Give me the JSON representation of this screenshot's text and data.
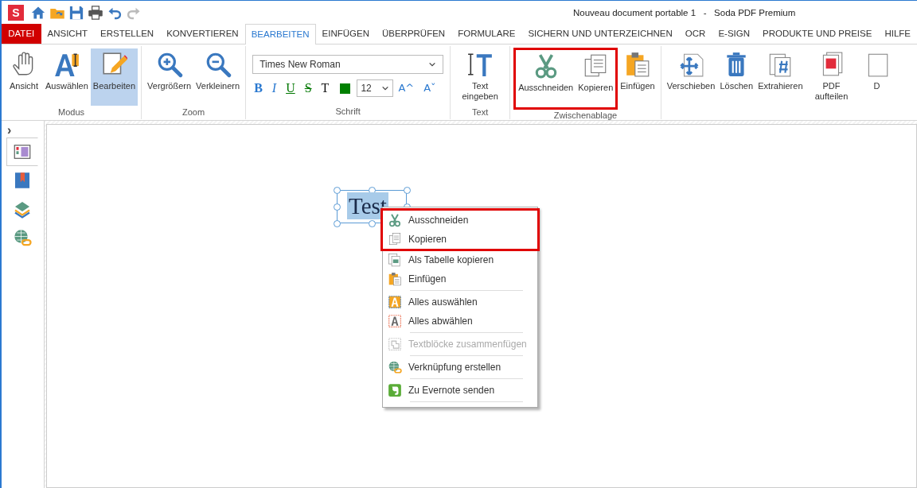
{
  "window": {
    "title": "Nouveau document portable 1   -   Soda PDF Premium",
    "logo": "S"
  },
  "tabs": [
    {
      "label": "DATEI",
      "kind": "file",
      "selected": false
    },
    {
      "label": "ANSICHT",
      "kind": "tab",
      "selected": false
    },
    {
      "label": "ERSTELLEN",
      "kind": "tab",
      "selected": false
    },
    {
      "label": "KONVERTIEREN",
      "kind": "tab",
      "selected": false
    },
    {
      "label": "BEARBEITEN",
      "kind": "tab",
      "selected": true
    },
    {
      "label": "EINFÜGEN",
      "kind": "tab",
      "selected": false
    },
    {
      "label": "ÜBERPRÜFEN",
      "kind": "tab",
      "selected": false
    },
    {
      "label": "FORMULARE",
      "kind": "tab",
      "selected": false
    },
    {
      "label": "SICHERN UND UNTERZEICHNEN",
      "kind": "tab",
      "selected": false
    },
    {
      "label": "OCR",
      "kind": "tab",
      "selected": false
    },
    {
      "label": "E-SIGN",
      "kind": "tab",
      "selected": false
    },
    {
      "label": "PRODUKTE UND PREISE",
      "kind": "tab",
      "selected": false
    },
    {
      "label": "HILFE",
      "kind": "tab",
      "selected": false
    }
  ],
  "ribbon": [
    {
      "label": "Modus",
      "kind": "buttons",
      "buttons": [
        {
          "label": "Ansicht",
          "selected": false,
          "highlighted": false
        },
        {
          "label": "Auswählen",
          "selected": false,
          "highlighted": false
        },
        {
          "label": "Bearbeiten",
          "selected": true,
          "highlighted": false
        }
      ]
    },
    {
      "label": "Zoom",
      "kind": "buttons",
      "buttons": [
        {
          "label": "Vergrößern",
          "selected": false,
          "highlighted": false
        },
        {
          "label": "Verkleinern",
          "selected": false,
          "highlighted": false
        }
      ]
    },
    {
      "label": "Schrift",
      "kind": "font",
      "font": "Times New Roman",
      "size": "12",
      "format": [
        "B",
        "I",
        "U",
        "S",
        "T"
      ],
      "color": "#008000",
      "grow": "A^",
      "shrink": "Aˇ"
    },
    {
      "label": "Text",
      "kind": "buttons",
      "buttons": [
        {
          "label": "Text eingeben",
          "selected": false,
          "highlighted": false
        }
      ]
    },
    {
      "label": "Zwischenablage",
      "kind": "buttons",
      "buttons": [
        {
          "label": "Ausschneiden",
          "selected": false,
          "highlighted": true
        },
        {
          "label": "Kopieren",
          "selected": false,
          "highlighted": true
        },
        {
          "label": "Einfügen",
          "selected": false,
          "highlighted": false
        }
      ]
    },
    {
      "kind": "buttons",
      "buttons": [
        {
          "label": "Verschieben",
          "selected": false,
          "highlighted": false
        },
        {
          "label": "Löschen",
          "selected": false,
          "highlighted": false
        },
        {
          "label": "Extrahieren",
          "selected": false,
          "highlighted": false
        },
        {
          "label": "PDF aufteilen",
          "selected": false,
          "highlighted": false
        },
        {
          "label": "D",
          "selected": false,
          "highlighted": false
        }
      ]
    }
  ],
  "sidebar": {
    "toggle": "›",
    "items": [
      {
        "selected": true
      },
      {
        "selected": false
      },
      {
        "selected": false
      },
      {
        "selected": false
      }
    ]
  },
  "document": {
    "text": "Test",
    "selected": true
  },
  "context_menu": [
    {
      "kind": "item",
      "label": "Ausschneiden",
      "disabled": false,
      "highlighted": true
    },
    {
      "kind": "item",
      "label": "Kopieren",
      "disabled": false,
      "highlighted": true
    },
    {
      "kind": "item",
      "label": "Als Tabelle kopieren",
      "disabled": false,
      "highlighted": false
    },
    {
      "kind": "item",
      "label": "Einfügen",
      "disabled": false,
      "highlighted": false
    },
    {
      "kind": "separator"
    },
    {
      "kind": "item",
      "label": "Alles auswählen",
      "disabled": false,
      "highlighted": false
    },
    {
      "kind": "item",
      "label": "Alles abwählen",
      "disabled": false,
      "highlighted": false
    },
    {
      "kind": "separator"
    },
    {
      "kind": "item",
      "label": "Textblöcke zusammenfügen",
      "disabled": true,
      "highlighted": false
    },
    {
      "kind": "separator"
    },
    {
      "kind": "item",
      "label": "Verknüpfung erstellen",
      "disabled": false,
      "highlighted": false
    },
    {
      "kind": "separator"
    },
    {
      "kind": "item",
      "label": "Zu Evernote senden",
      "disabled": false,
      "highlighted": false
    },
    {
      "kind": "separator"
    }
  ]
}
